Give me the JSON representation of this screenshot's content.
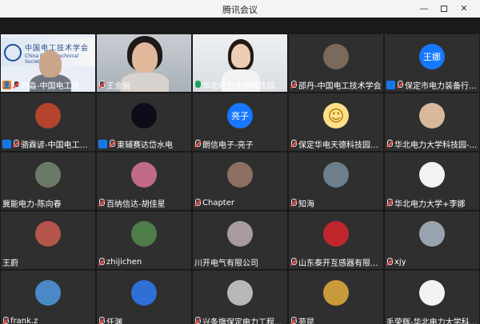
{
  "window": {
    "title": "腾讯会议"
  },
  "tiles": [
    {
      "name": "刘淼-中国电工技术...",
      "badge": "host",
      "mic": "muted",
      "kind": "video",
      "scene": "banner",
      "banner_text": "中国电工技术学会",
      "banner_sub": "China Electrotechnical Society"
    },
    {
      "name": "王金丽",
      "mic": "muted",
      "kind": "video",
      "scene": "woman1"
    },
    {
      "name": "华北电力大学科技园...",
      "mic": "active",
      "kind": "video",
      "scene": "woman2",
      "speaking": true
    },
    {
      "name": "邵丹-中国电工技术学会",
      "mic": "muted",
      "kind": "avatar",
      "avatar_color": "#7a6a5a"
    },
    {
      "name": "保定市电力装备行...",
      "badge": "user",
      "mic": "muted",
      "kind": "avatar",
      "avatar_text": "王娜",
      "avatar_color": "#1677ff"
    },
    {
      "name": "骆霖谚-中国电工技...",
      "badge": "user",
      "mic": "muted",
      "kind": "avatar",
      "avatar_color": "#b5442c"
    },
    {
      "name": "東辅赛达岱水电",
      "badge": "user",
      "mic": "muted",
      "kind": "avatar",
      "avatar_color": "#0d0d1a"
    },
    {
      "name": "朗信电子-亮子",
      "mic": "muted",
      "kind": "avatar",
      "avatar_text": "亮子",
      "avatar_color": "#1677ff"
    },
    {
      "name": "保定华电天德科技园有...",
      "mic": "muted",
      "kind": "avatar",
      "avatar_emoji": "☺",
      "avatar_color": "#ffe08a"
    },
    {
      "name": "华北电力大学科技园-...",
      "mic": "muted",
      "kind": "avatar",
      "avatar_color": "#d9b99b"
    },
    {
      "name": "冀能电力-陈向春",
      "mic": "none",
      "kind": "avatar",
      "avatar_color": "#6b7a66"
    },
    {
      "name": "百纳信达-胡佳星",
      "mic": "muted",
      "kind": "avatar",
      "avatar_color": "#c06a8a"
    },
    {
      "name": "Chapter",
      "mic": "muted",
      "kind": "avatar",
      "avatar_color": "#8d6e63"
    },
    {
      "name": "知海",
      "mic": "muted",
      "kind": "avatar",
      "avatar_color": "#6d7f8c"
    },
    {
      "name": "华北电力大学+李娜",
      "mic": "muted",
      "kind": "avatar",
      "avatar_color": "#f2f2f2"
    },
    {
      "name": "王蔚",
      "mic": "none",
      "kind": "avatar",
      "avatar_color": "#b3554a"
    },
    {
      "name": "zhijichen",
      "mic": "muted",
      "kind": "avatar",
      "avatar_color": "#4e7d4a"
    },
    {
      "name": "川开电气有限公司",
      "mic": "none",
      "kind": "avatar",
      "avatar_color": "#a89aa0"
    },
    {
      "name": "山东泰开互感器有限...",
      "mic": "muted",
      "kind": "avatar",
      "avatar_color": "#c0272d"
    },
    {
      "name": "xjy",
      "mic": "muted",
      "kind": "avatar",
      "avatar_color": "#9aa4b0"
    },
    {
      "name": "frank.z",
      "mic": "muted",
      "kind": "avatar",
      "avatar_color": "#4b88c7"
    },
    {
      "name": "任渊",
      "mic": "muted",
      "kind": "avatar",
      "avatar_color": "#2f6fd6"
    },
    {
      "name": "兴条旗保定电力工程...",
      "mic": "muted",
      "kind": "avatar",
      "avatar_color": "#b8b8b8"
    },
    {
      "name": "苑昆",
      "mic": "muted",
      "kind": "avatar",
      "avatar_color": "#c89a3a"
    },
    {
      "name": "毛荣辉-华北电力大学科...",
      "mic": "none",
      "kind": "avatar",
      "avatar_color": "#f3f3f3"
    }
  ]
}
